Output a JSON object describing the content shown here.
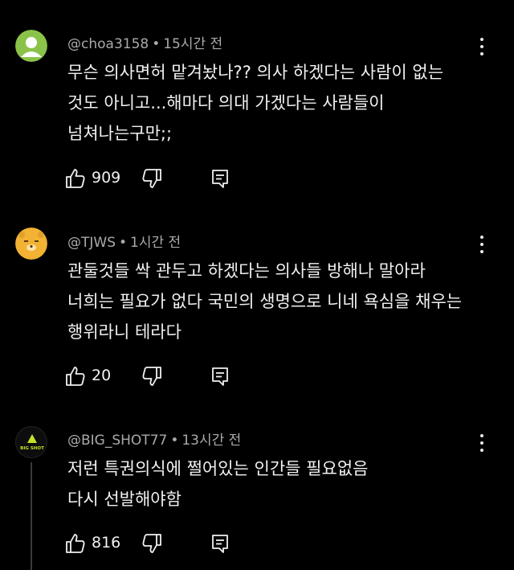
{
  "comments": [
    {
      "handle": "@choa3158",
      "time": "15시간 전",
      "text": "무슨 의사면허 맡겨놨나?? 의사 하겠다는 사람이 없는\n것도 아니고...해마다 의대 가겠다는 사람들이\n넘쳐나는구만;;",
      "likes": "909",
      "avatar_color": "#8bc34a"
    },
    {
      "handle": "@TJWS",
      "time": "1시간 전",
      "text": "관둘것들 싹 관두고 하겠다는 의사들 방해나 말아라\n너희는 필요가 없다 국민의 생명으로 니네 욕심을 채우는\n행위라니 테라다",
      "likes": "20",
      "avatar_color": "#f2b233"
    },
    {
      "handle": "@BIG_SHOT77",
      "time": "13시간 전",
      "text": "저런 특권의식에 쩔어있는 인간들 필요없음\n다시 선발해야함",
      "likes": "816",
      "avatar_color": "#0d0d0d",
      "avatar_text": "BIG SHOT"
    }
  ],
  "meta_separator": "•"
}
